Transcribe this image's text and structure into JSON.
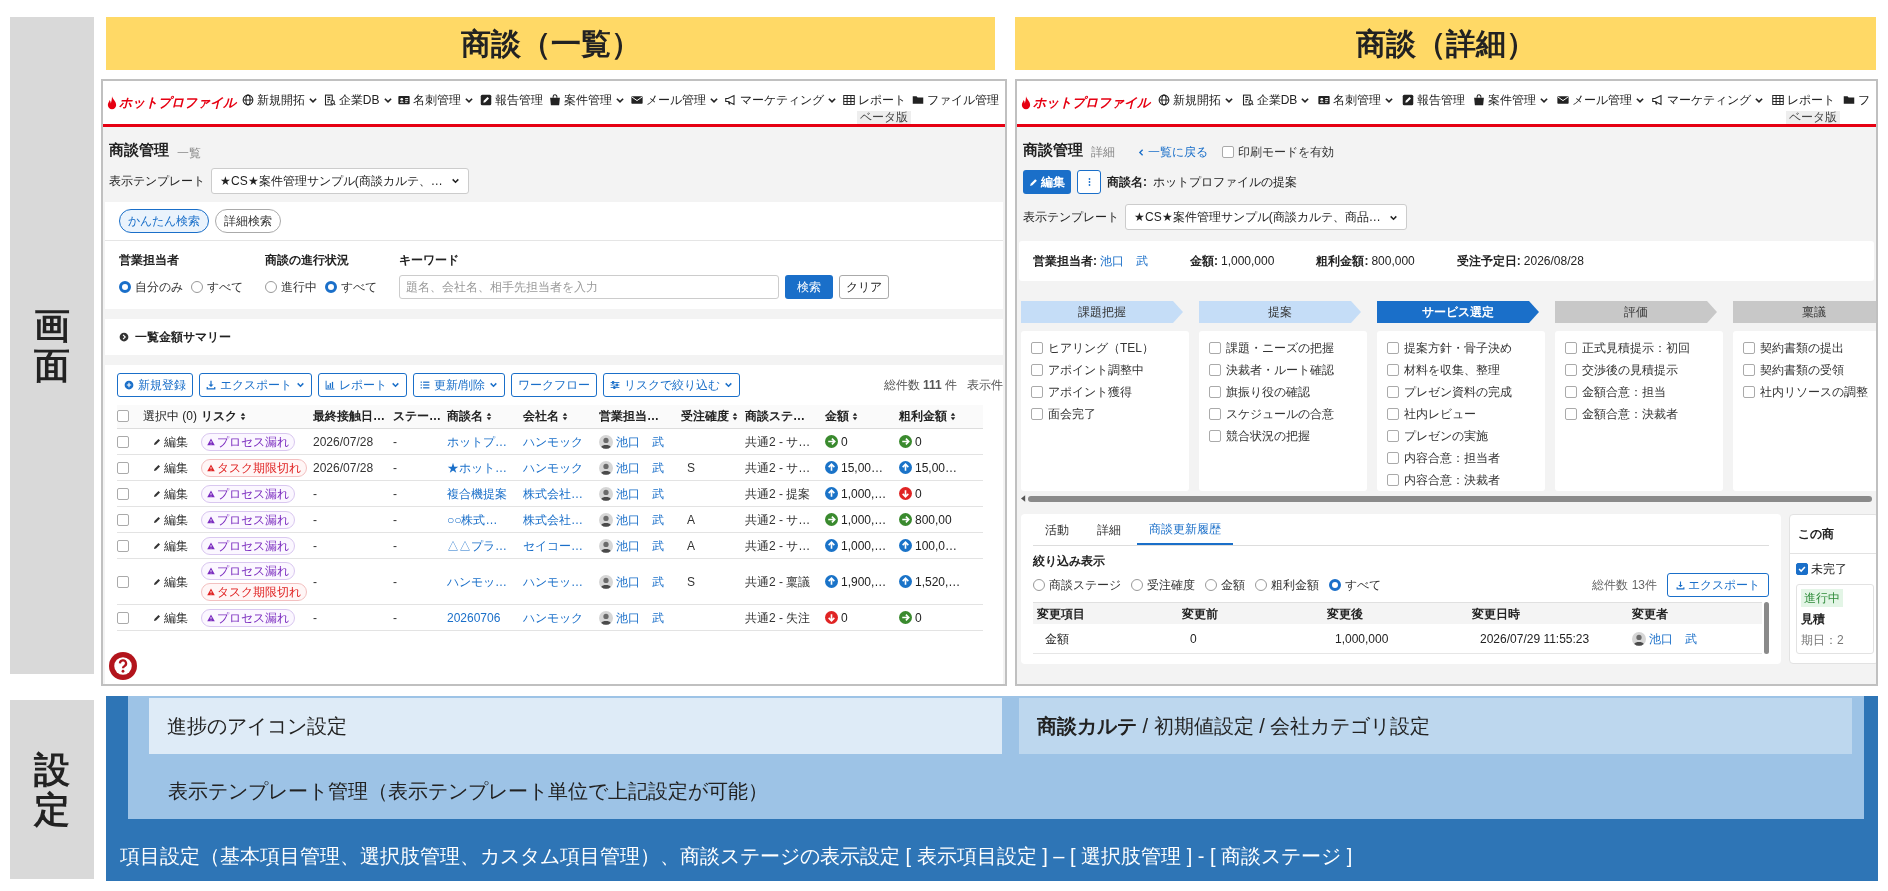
{
  "screen_label": "画面",
  "list_view": {
    "title": "商談（一覧）",
    "nav": {
      "logo": "ホットプロファイル",
      "items": [
        {
          "label": "新規開拓",
          "dropdown": true
        },
        {
          "label": "企業DB",
          "dropdown": true
        },
        {
          "label": "名刺管理",
          "dropdown": true
        },
        {
          "label": "報告管理",
          "dropdown": false
        },
        {
          "label": "案件管理",
          "dropdown": true
        },
        {
          "label": "メール管理",
          "dropdown": true
        },
        {
          "label": "マーケティング",
          "dropdown": true
        },
        {
          "label": "レポート",
          "dropdown": false,
          "badge": "ベータ版"
        },
        {
          "label": "ファイル管理",
          "dropdown": false
        }
      ]
    },
    "page_title": "商談管理",
    "page_subtitle": "一覧",
    "template": {
      "label": "表示テンプレート",
      "value": "★CS★案件管理サンプル(商談カルテ、…"
    },
    "search_tabs": [
      {
        "label": "かんたん検索",
        "selected": true
      },
      {
        "label": "詳細検索",
        "selected": false
      }
    ],
    "filters": [
      {
        "label": "営業担当者",
        "options": [
          {
            "label": "自分のみ",
            "selected": true
          },
          {
            "label": "すべて",
            "selected": false
          }
        ]
      },
      {
        "label": "商談の進行状況",
        "options": [
          {
            "label": "進行中",
            "selected": false
          },
          {
            "label": "すべて",
            "selected": true
          }
        ]
      }
    ],
    "keyword": {
      "label": "キーワード",
      "placeholder": "題名、会社名、相手先担当者を入力"
    },
    "search_buttons": [
      "検索",
      "クリア"
    ],
    "summary": "一覧金額サマリー",
    "toolbar": [
      {
        "label": "新規登録",
        "dropdown": false
      },
      {
        "label": "エクスポート",
        "dropdown": true
      },
      {
        "label": "レポート",
        "dropdown": true
      },
      {
        "label": "更新/削除",
        "dropdown": true
      },
      {
        "label": "ワークフロー",
        "dropdown": false
      },
      {
        "label": "リスクで絞り込む",
        "dropdown": true
      }
    ],
    "total": "総件数 **111** 件",
    "per_page": "表示件",
    "table": {
      "select_all_checked": false,
      "columns": [
        {
          "label": "選択中 (0)",
          "sortable": false
        },
        {
          "label": "リスク",
          "sortable": true
        },
        {
          "label": "最終接触日…",
          "sortable": false
        },
        {
          "label": "ステー…",
          "sortable": false
        },
        {
          "label": "商談名",
          "sortable": true
        },
        {
          "label": "会社名",
          "sortable": true
        },
        {
          "label": "営業担当…",
          "sortable": false
        },
        {
          "label": "受注確度",
          "sortable": true
        },
        {
          "label": "商談ステ…",
          "sortable": false
        },
        {
          "label": "金額",
          "sortable": true
        },
        {
          "label": "粗利金額",
          "sortable": true
        }
      ],
      "rows": [
        {
          "checked": false,
          "edit": "編集",
          "risks": [
            {
              "kind": "process",
              "label": "プロセス漏れ"
            }
          ],
          "last_contact": "2026/07/28",
          "status": "-",
          "deal": "ホットプ…",
          "company": "ハンモック",
          "owner": "池口　武",
          "stage": "共通2 - サ…",
          "amount": {
            "kind": "right",
            "value": "0"
          },
          "gross": {
            "kind": "right",
            "value": "0"
          }
        },
        {
          "checked": false,
          "edit": "編集",
          "risks": [
            {
              "kind": "task",
              "label": "タスク期限切れ"
            }
          ],
          "last_contact": "2026/07/28",
          "status": "-",
          "deal": "★ホット…",
          "company": "ハンモック",
          "owner": "池口　武",
          "probability": "S",
          "stage": "共通2 - サ…",
          "amount": {
            "kind": "up",
            "value": "15,00…"
          },
          "gross": {
            "kind": "up",
            "value": "15,00…"
          }
        },
        {
          "checked": false,
          "edit": "編集",
          "risks": [
            {
              "kind": "process",
              "label": "プロセス漏れ"
            }
          ],
          "last_contact": "-",
          "status": "-",
          "deal": "複合機提案",
          "company": "株式会社…",
          "owner": "池口　武",
          "stage": "共通2 - 提案",
          "amount": {
            "kind": "up",
            "value": "1,000,…"
          },
          "gross": {
            "kind": "down",
            "value": "0"
          }
        },
        {
          "checked": false,
          "edit": "編集",
          "risks": [
            {
              "kind": "process",
              "label": "プロセス漏れ"
            }
          ],
          "last_contact": "-",
          "status": "-",
          "deal": "○○株式…",
          "company": "株式会社…",
          "owner": "池口　武",
          "probability": "A",
          "stage": "共通2 - サ…",
          "amount": {
            "kind": "right",
            "value": "1,000,…"
          },
          "gross": {
            "kind": "right",
            "value": "800,00"
          }
        },
        {
          "checked": false,
          "edit": "編集",
          "risks": [
            {
              "kind": "process",
              "label": "プロセス漏れ"
            }
          ],
          "last_contact": "-",
          "status": "-",
          "deal": "△△プラ…",
          "company": "セイコー…",
          "owner": "池口　武",
          "probability": "A",
          "stage": "共通2 - サ…",
          "amount": {
            "kind": "up",
            "value": "1,000,…"
          },
          "gross": {
            "kind": "up",
            "value": "100,0…"
          }
        },
        {
          "checked": false,
          "edit": "編集",
          "risks": [
            {
              "kind": "process",
              "label": "プロセス漏れ"
            },
            {
              "kind": "task",
              "label": "タスク期限切れ"
            }
          ],
          "last_contact": "-",
          "status": "-",
          "deal": "ハンモッ…",
          "company": "ハンモッ…",
          "owner": "池口　武",
          "probability": "S",
          "stage": "共通2 - 稟議",
          "amount": {
            "kind": "up",
            "value": "1,900,…"
          },
          "gross": {
            "kind": "up",
            "value": "1,520,…"
          }
        },
        {
          "checked": false,
          "edit": "編集",
          "risks": [
            {
              "kind": "process",
              "label": "プロセス漏れ"
            }
          ],
          "last_contact": "-",
          "status": "-",
          "deal": "20260706",
          "company": "ハンモック",
          "owner": "池口　武",
          "stage": "共通2 - 失注",
          "amount": {
            "kind": "down",
            "value": "0"
          },
          "gross": {
            "kind": "right",
            "value": "0"
          }
        }
      ]
    }
  },
  "detail_view": {
    "title": "商談（詳細）",
    "nav": {
      "logo": "ホットプロファイル",
      "items": [
        {
          "label": "新規開拓",
          "dropdown": true
        },
        {
          "label": "企業DB",
          "dropdown": true
        },
        {
          "label": "名刺管理",
          "dropdown": true
        },
        {
          "label": "報告管理",
          "dropdown": false
        },
        {
          "label": "案件管理",
          "dropdown": true
        },
        {
          "label": "メール管理",
          "dropdown": true
        },
        {
          "label": "マーケティング",
          "dropdown": true
        },
        {
          "label": "レポート",
          "dropdown": false,
          "badge": "ベータ版"
        },
        {
          "label": "フ",
          "dropdown": false
        }
      ]
    },
    "page_title": "商談管理",
    "page_subtitle": "詳細",
    "back_link": "一覧に戻る",
    "print_mode": {
      "label": "印刷モードを有効",
      "checked": false
    },
    "edit_button": "編集",
    "deal_name": {
      "label": "商談名:",
      "value": "ホットプロファイルの提案"
    },
    "template": {
      "label": "表示テンプレート",
      "value": "★CS★案件管理サンプル(商談カルテ、商品…"
    },
    "summary_fields": [
      {
        "label": "営業担当者:",
        "value": "池口　武",
        "kind": "link"
      },
      {
        "label": "金額:",
        "value": "1,000,000",
        "kind": "text"
      },
      {
        "label": "粗利金額:",
        "value": "800,000",
        "kind": "text"
      },
      {
        "label": "受注予定日:",
        "value": "2026/08/28",
        "kind": "text"
      }
    ],
    "stages": [
      {
        "label": "課題把握",
        "kind": "done",
        "tasks": [
          {
            "label": "ヒアリング（TEL）",
            "checked": false
          },
          {
            "label": "アポイント調整中",
            "checked": false
          },
          {
            "label": "アポイント獲得",
            "checked": false
          },
          {
            "label": "面会完了",
            "checked": false
          }
        ]
      },
      {
        "label": "提案",
        "kind": "done",
        "tasks": [
          {
            "label": "課題・ニーズの把握",
            "checked": false
          },
          {
            "label": "決裁者・ルート確認",
            "checked": false
          },
          {
            "label": "旗振り役の確認",
            "checked": false
          },
          {
            "label": "スケジュールの合意",
            "checked": false
          },
          {
            "label": "競合状況の把握",
            "checked": false
          }
        ]
      },
      {
        "label": "サービス選定",
        "kind": "current",
        "tasks": [
          {
            "label": "提案方針・骨子決め",
            "checked": false
          },
          {
            "label": "材料を収集、整理",
            "checked": false
          },
          {
            "label": "プレゼン資料の完成",
            "checked": false
          },
          {
            "label": "社内レビュー",
            "checked": false
          },
          {
            "label": "プレゼンの実施",
            "checked": false
          },
          {
            "label": "内容合意：担当者",
            "checked": false
          },
          {
            "label": "内容合意：決裁者",
            "checked": false
          }
        ]
      },
      {
        "label": "評価",
        "kind": "todo",
        "tasks": [
          {
            "label": "正式見積提示：初回",
            "checked": false
          },
          {
            "label": "交渉後の見積提示",
            "checked": false
          },
          {
            "label": "金額合意：担当",
            "checked": false
          },
          {
            "label": "金額合意：決裁者",
            "checked": false
          }
        ]
      },
      {
        "label": "稟議",
        "kind": "todo",
        "tasks": [
          {
            "label": "契約書類の提出",
            "checked": false
          },
          {
            "label": "契約書類の受領",
            "checked": false
          },
          {
            "label": "社内リソースの調整",
            "checked": false
          }
        ]
      }
    ],
    "tabs": [
      {
        "label": "活動",
        "selected": false
      },
      {
        "label": "詳細",
        "selected": false
      },
      {
        "label": "商談更新履歴",
        "selected": true
      }
    ],
    "filter_label": "絞り込み表示",
    "filter_options": [
      {
        "label": "商談ステージ",
        "selected": false
      },
      {
        "label": "受注確度",
        "selected": false
      },
      {
        "label": "金額",
        "selected": false
      },
      {
        "label": "粗利金額",
        "selected": false
      },
      {
        "label": "すべて",
        "selected": true
      }
    ],
    "total": "総件数 13件",
    "export_button": "エクスポート",
    "history": {
      "columns": [
        "変更項目",
        "変更前",
        "変更後",
        "変更日時",
        "変更者"
      ],
      "rows": [
        {
          "field": "金額",
          "before": "0",
          "after": "1,000,000",
          "changed_at": "2026/07/29 11:55:23",
          "changed_by": "池口　武"
        }
      ]
    },
    "side_card": {
      "title": "この商",
      "filter": {
        "label": "未完了",
        "checked": true
      },
      "task": {
        "status": "進行中",
        "title": "見積",
        "due": "期日：2"
      }
    }
  },
  "settings": {
    "label": "設定",
    "boxes": [
      "進捗のアイコン設定",
      "**商談カルテ** / 初期値設定 / 会社カテゴリ設定"
    ],
    "template_note": "表示テンプレート管理（表示テンプレート単位で上記設定が可能）",
    "item_settings": "項目設定（基本項目管理、選択肢管理、カスタム項目管理）、商談ステージの表示設定 [ 表示項目設定 ] – [ 選択肢管理 ] - [ 商談ステージ ]"
  }
}
